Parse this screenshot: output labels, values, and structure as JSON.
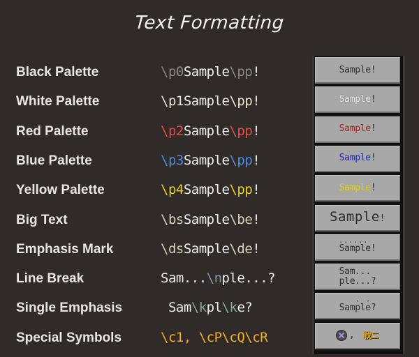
{
  "title": "Text Formatting",
  "colors": {
    "background": "#302a28",
    "label": "#e9e6e1",
    "sample_text": "#f2f0ec",
    "code_black": "#8a8684",
    "code_white": "#e8e6d8",
    "code_red": "#e84c4c",
    "code_blue": "#4a90e2",
    "code_yellow": "#e6d020",
    "code_beige": "#d8d2c2",
    "code_grayblue": "#8e94a6",
    "code_teal": "#7fa99a",
    "code_gold": "#f0b020",
    "preview_bg": "#a8a8a8",
    "preview_text": "#2e2e2e",
    "preview_white": "#ececec",
    "preview_red": "#b51c1c",
    "preview_blue": "#1c22c8",
    "preview_yellow": "#d8d21a"
  },
  "rows": [
    {
      "label": "Black Palette",
      "code": [
        {
          "text": "\\p0",
          "color": "#8a8684"
        },
        {
          "text": "Sample",
          "color": "#f2f0ec"
        },
        {
          "text": "\\pp",
          "color": "#8a8684"
        },
        {
          "text": "!",
          "color": "#f2f0ec"
        }
      ],
      "preview": {
        "type": "colored",
        "text": "Sample",
        "suffix": "!",
        "color": "#2e2e2e"
      }
    },
    {
      "label": "White Palette",
      "code": [
        {
          "text": "\\p1",
          "color": "#e8e6d8"
        },
        {
          "text": "Sample",
          "color": "#f2f0ec"
        },
        {
          "text": "\\pp",
          "color": "#e8e6d8"
        },
        {
          "text": "!",
          "color": "#f2f0ec"
        }
      ],
      "preview": {
        "type": "colored",
        "text": "Sample",
        "suffix": "!",
        "color": "#ececec"
      }
    },
    {
      "label": "Red Palette",
      "code": [
        {
          "text": "\\p2",
          "color": "#e84c4c"
        },
        {
          "text": "Sample",
          "color": "#f2f0ec"
        },
        {
          "text": "\\pp",
          "color": "#e84c4c"
        },
        {
          "text": "!",
          "color": "#f2f0ec"
        }
      ],
      "preview": {
        "type": "colored",
        "text": "Sample",
        "suffix": "!",
        "color": "#b51c1c"
      }
    },
    {
      "label": "Blue Palette",
      "code": [
        {
          "text": "\\p3",
          "color": "#4a90e2"
        },
        {
          "text": "Sample",
          "color": "#f2f0ec"
        },
        {
          "text": "\\pp",
          "color": "#4a90e2"
        },
        {
          "text": "!",
          "color": "#f2f0ec"
        }
      ],
      "preview": {
        "type": "colored",
        "text": "Sample",
        "suffix": "!",
        "color": "#1c22c8"
      }
    },
    {
      "label": "Yellow Palette",
      "code": [
        {
          "text": "\\p4",
          "color": "#e6d020"
        },
        {
          "text": "Sample",
          "color": "#f2f0ec"
        },
        {
          "text": "\\pp",
          "color": "#e6d020"
        },
        {
          "text": "!",
          "color": "#f2f0ec"
        }
      ],
      "preview": {
        "type": "colored",
        "text": "Sample",
        "suffix": "!",
        "color": "#d8d21a"
      }
    },
    {
      "label": "Big Text",
      "code": [
        {
          "text": "\\bs",
          "color": "#d8d2c2"
        },
        {
          "text": "Sample",
          "color": "#f2f0ec"
        },
        {
          "text": "\\be",
          "color": "#d8d2c2"
        },
        {
          "text": "!",
          "color": "#f2f0ec"
        }
      ],
      "preview": {
        "type": "big",
        "text": "Sample",
        "suffix": "!"
      }
    },
    {
      "label": "Emphasis Mark",
      "code": [
        {
          "text": "\\ds",
          "color": "#d8d2c2"
        },
        {
          "text": "Sample",
          "color": "#f2f0ec"
        },
        {
          "text": "\\de",
          "color": "#d8d2c2"
        },
        {
          "text": "!",
          "color": "#f2f0ec"
        }
      ],
      "preview": {
        "type": "dots",
        "text": "Sample",
        "suffix": "!"
      }
    },
    {
      "label": "Line Break",
      "code": [
        {
          "text": "Sam...",
          "color": "#f2f0ec"
        },
        {
          "text": "\\n",
          "color": "#8e94a6"
        },
        {
          "text": "ple...?",
          "color": "#f2f0ec"
        }
      ],
      "preview": {
        "type": "multiline",
        "lines": [
          "Sam...",
          "ple...?"
        ]
      }
    },
    {
      "label": "Single Emphasis",
      "code": [
        {
          "text": " Sam",
          "color": "#f2f0ec"
        },
        {
          "text": "\\k",
          "color": "#7fa99a"
        },
        {
          "text": "pl",
          "color": "#f2f0ec"
        },
        {
          "text": "\\k",
          "color": "#7fa99a"
        },
        {
          "text": "e?",
          "color": "#f2f0ec"
        }
      ],
      "preview": {
        "type": "single",
        "before": "Sam",
        "marked1": "p",
        "middle": "l",
        "marked2": "e",
        "suffix": "?"
      }
    },
    {
      "label": "Special Symbols",
      "code": [
        {
          "text": "\\c1, \\cP\\cQ\\cR",
          "color": "#f0b020"
        }
      ],
      "preview": {
        "type": "symbols",
        "icon": "cross-button-icon",
        "separator": ",",
        "glyph": "戦ニ"
      }
    }
  ]
}
